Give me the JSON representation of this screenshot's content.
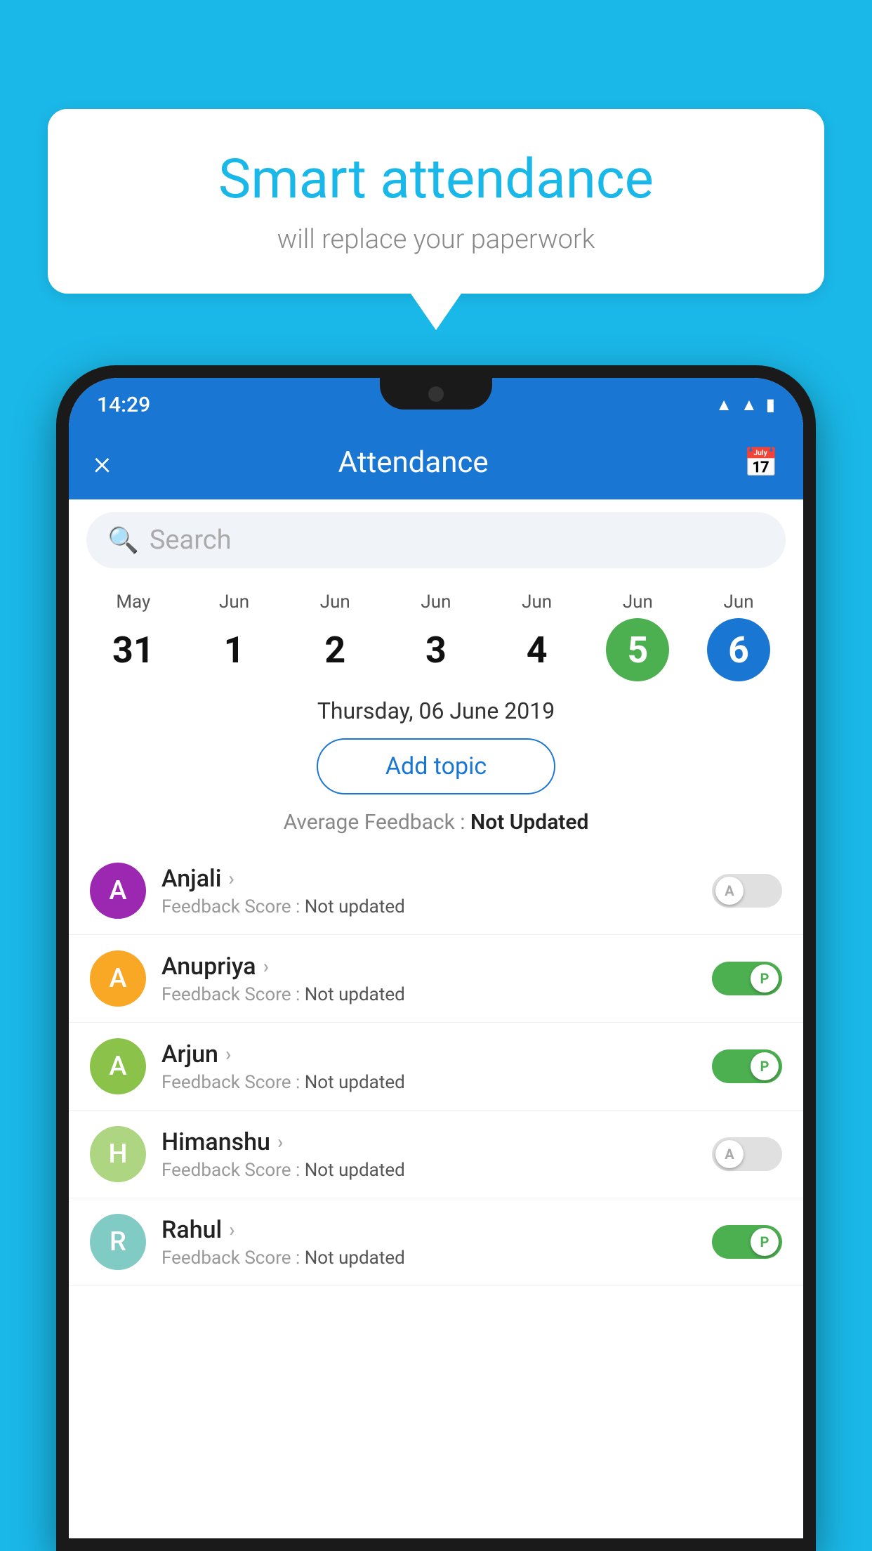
{
  "background": {
    "color": "#1ab8e8"
  },
  "bubble": {
    "title": "Smart attendance",
    "subtitle": "will replace your paperwork"
  },
  "statusBar": {
    "time": "14:29",
    "icons": [
      "wifi",
      "signal",
      "battery"
    ]
  },
  "appBar": {
    "title": "Attendance",
    "closeLabel": "×",
    "calendarLabel": "📅"
  },
  "search": {
    "placeholder": "Search"
  },
  "calendar": {
    "days": [
      {
        "month": "May",
        "num": "31",
        "state": "normal"
      },
      {
        "month": "Jun",
        "num": "1",
        "state": "normal"
      },
      {
        "month": "Jun",
        "num": "2",
        "state": "normal"
      },
      {
        "month": "Jun",
        "num": "3",
        "state": "normal"
      },
      {
        "month": "Jun",
        "num": "4",
        "state": "normal"
      },
      {
        "month": "Jun",
        "num": "5",
        "state": "today"
      },
      {
        "month": "Jun",
        "num": "6",
        "state": "selected"
      }
    ]
  },
  "dateLabel": "Thursday, 06 June 2019",
  "addTopicLabel": "Add topic",
  "avgFeedback": {
    "label": "Average Feedback : ",
    "value": "Not Updated"
  },
  "students": [
    {
      "name": "Anjali",
      "avatarColor": "#9c27b0",
      "avatarLetter": "A",
      "feedbackLabel": "Feedback Score : ",
      "feedbackValue": "Not updated",
      "toggleState": "off",
      "toggleLabel": "A"
    },
    {
      "name": "Anupriya",
      "avatarColor": "#f9a825",
      "avatarLetter": "A",
      "feedbackLabel": "Feedback Score : ",
      "feedbackValue": "Not updated",
      "toggleState": "on",
      "toggleLabel": "P"
    },
    {
      "name": "Arjun",
      "avatarColor": "#8bc34a",
      "avatarLetter": "A",
      "feedbackLabel": "Feedback Score : ",
      "feedbackValue": "Not updated",
      "toggleState": "on",
      "toggleLabel": "P"
    },
    {
      "name": "Himanshu",
      "avatarColor": "#aed581",
      "avatarLetter": "H",
      "feedbackLabel": "Feedback Score : ",
      "feedbackValue": "Not updated",
      "toggleState": "off",
      "toggleLabel": "A"
    },
    {
      "name": "Rahul",
      "avatarColor": "#80cbc4",
      "avatarLetter": "R",
      "feedbackLabel": "Feedback Score : ",
      "feedbackValue": "Not updated",
      "toggleState": "on",
      "toggleLabel": "P"
    }
  ]
}
